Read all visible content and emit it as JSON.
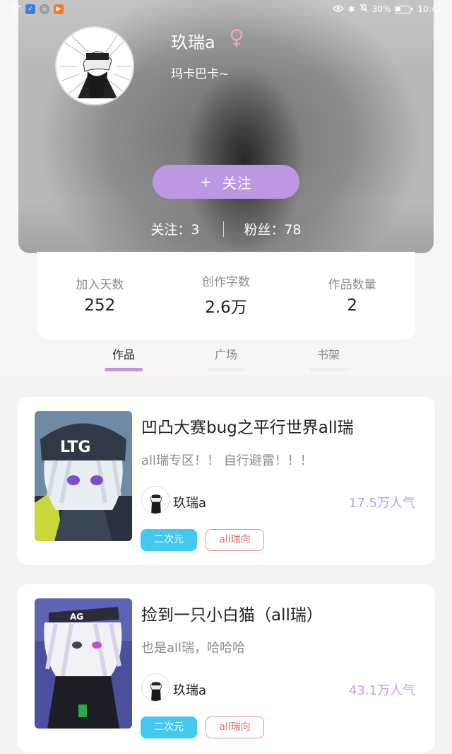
{
  "status_bar": {
    "battery": "30%",
    "time": "10:47"
  },
  "profile": {
    "name": "玖瑞a",
    "gender_icon": "♀",
    "bio": "玛卡巴卡~",
    "follow_button": {
      "icon": "+",
      "label": "关注"
    },
    "following_label": "关注：",
    "following_count": "3",
    "fans_label": "粉丝：",
    "fans_count": "78"
  },
  "stats": [
    {
      "label": "加入天数",
      "value": "252"
    },
    {
      "label": "创作字数",
      "value": "2.6万"
    },
    {
      "label": "作品数量",
      "value": "2"
    }
  ],
  "tabs": [
    {
      "label": "作品",
      "active": true
    },
    {
      "label": "广场",
      "active": false
    },
    {
      "label": "书架",
      "active": false
    }
  ],
  "works": [
    {
      "title": "凹凸大赛bug之平行世界all瑞",
      "description": "all瑞专区！！ 自行避雷！！！",
      "author": "玖瑞a",
      "popularity": "17.5万人气",
      "tags": [
        "二次元",
        "all瑞向"
      ]
    },
    {
      "title": "捡到一只小白猫（all瑞）",
      "description": "也是all瑞，哈哈哈",
      "author": "玖瑞a",
      "popularity": "43.1万人气",
      "tags": [
        "二次元",
        "all瑞向"
      ]
    }
  ],
  "colors": {
    "accent": "#bd97e3",
    "popularity": "#c59ce5",
    "tag_blue": "#43c8ef",
    "tag_red": "#e26c6c",
    "gender": "#f2a0c0"
  },
  "icons": [
    "wifi-icon",
    "eye-icon",
    "bluetooth-icon",
    "mute-icon",
    "battery-icon",
    "female-icon",
    "plus-icon"
  ]
}
